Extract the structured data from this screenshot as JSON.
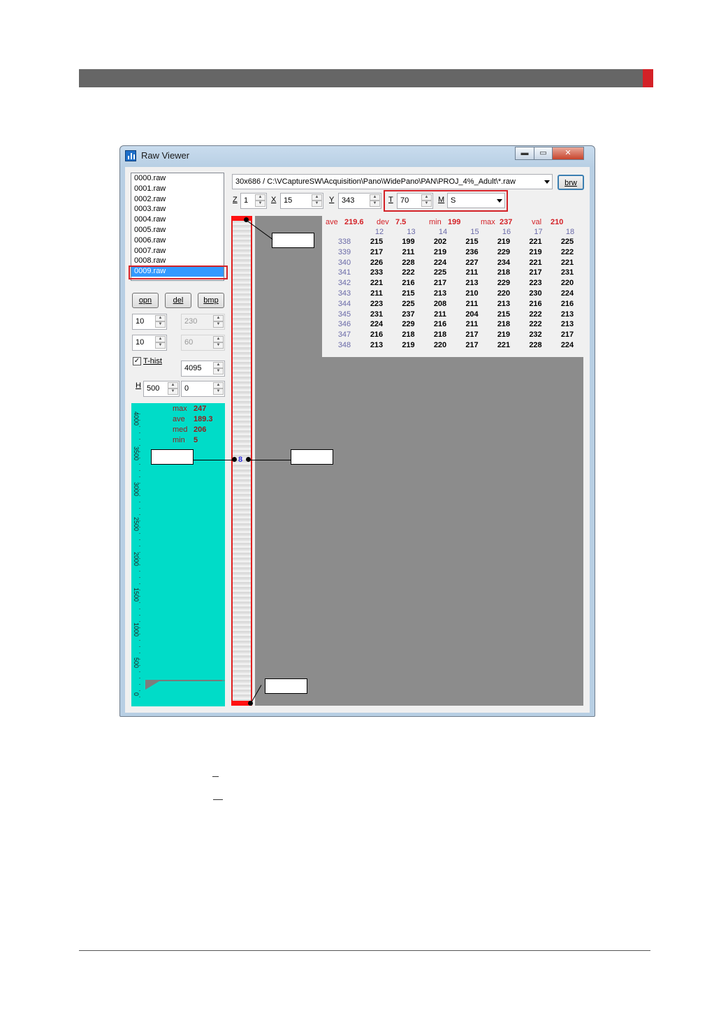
{
  "window": {
    "title": "Raw Viewer",
    "minimize": "▬",
    "maximize": "▭",
    "close": "✕"
  },
  "files": [
    "0000.raw",
    "0001.raw",
    "0002.raw",
    "0003.raw",
    "0004.raw",
    "0005.raw",
    "0006.raw",
    "0007.raw",
    "0008.raw",
    "0009.raw"
  ],
  "selected_file": "0009.raw",
  "buttons": {
    "open": "opn",
    "delete": "del",
    "bitmap": "bmp",
    "browse": "brw"
  },
  "spinners": {
    "roi_w": "10",
    "roi_h": "10",
    "max_w": "230",
    "max_h": "60",
    "hist_max": "4095",
    "h_value": "500",
    "h_offset": "0"
  },
  "thist": {
    "label": "T-hist",
    "checked": "✓"
  },
  "h_label": "H",
  "histogram": {
    "ticks": [
      "4000",
      "3500",
      "3000",
      "2500",
      "2000",
      "1500",
      "1000",
      "500",
      "0"
    ],
    "stats": [
      {
        "label": "max",
        "value": "247"
      },
      {
        "label": "ave",
        "value": "189.3"
      },
      {
        "label": "med",
        "value": "206"
      },
      {
        "label": "min",
        "value": "5"
      }
    ]
  },
  "path": "30x686 / C:\\VCaptureSW\\Acquisition\\Pano\\WidePano\\PAN\\PROJ_4%_Adult\\*.raw",
  "controls": {
    "z_label": "Z",
    "z_value": "1",
    "x_label": "X",
    "x_value": "15",
    "y_label": "Y",
    "y_value": "343",
    "t_label": "T",
    "t_value": "70",
    "m_label": "M",
    "m_value": "S"
  },
  "marker": "8",
  "stats": [
    {
      "label": "ave",
      "value": "219.6"
    },
    {
      "label": "dev",
      "value": "7.5"
    },
    {
      "label": "min",
      "value": "199"
    },
    {
      "label": "max",
      "value": "237"
    },
    {
      "label": "val",
      "value": "210"
    }
  ],
  "columns": [
    "12",
    "13",
    "14",
    "15",
    "16",
    "17",
    "18"
  ],
  "rows": [
    {
      "y": "338",
      "v": [
        "215",
        "199",
        "202",
        "215",
        "219",
        "221",
        "225"
      ]
    },
    {
      "y": "339",
      "v": [
        "217",
        "211",
        "219",
        "236",
        "229",
        "219",
        "222"
      ]
    },
    {
      "y": "340",
      "v": [
        "226",
        "228",
        "224",
        "227",
        "234",
        "221",
        "221"
      ]
    },
    {
      "y": "341",
      "v": [
        "233",
        "222",
        "225",
        "211",
        "218",
        "217",
        "231"
      ]
    },
    {
      "y": "342",
      "v": [
        "221",
        "216",
        "217",
        "213",
        "229",
        "223",
        "220"
      ]
    },
    {
      "y": "343",
      "v": [
        "211",
        "215",
        "213",
        "210",
        "220",
        "230",
        "224"
      ]
    },
    {
      "y": "344",
      "v": [
        "223",
        "225",
        "208",
        "211",
        "213",
        "216",
        "216"
      ]
    },
    {
      "y": "345",
      "v": [
        "231",
        "237",
        "211",
        "204",
        "215",
        "222",
        "213"
      ]
    },
    {
      "y": "346",
      "v": [
        "224",
        "229",
        "216",
        "211",
        "218",
        "222",
        "213"
      ]
    },
    {
      "y": "347",
      "v": [
        "216",
        "218",
        "218",
        "217",
        "219",
        "232",
        "217"
      ]
    },
    {
      "y": "348",
      "v": [
        "213",
        "219",
        "220",
        "217",
        "221",
        "228",
        "224"
      ]
    }
  ]
}
